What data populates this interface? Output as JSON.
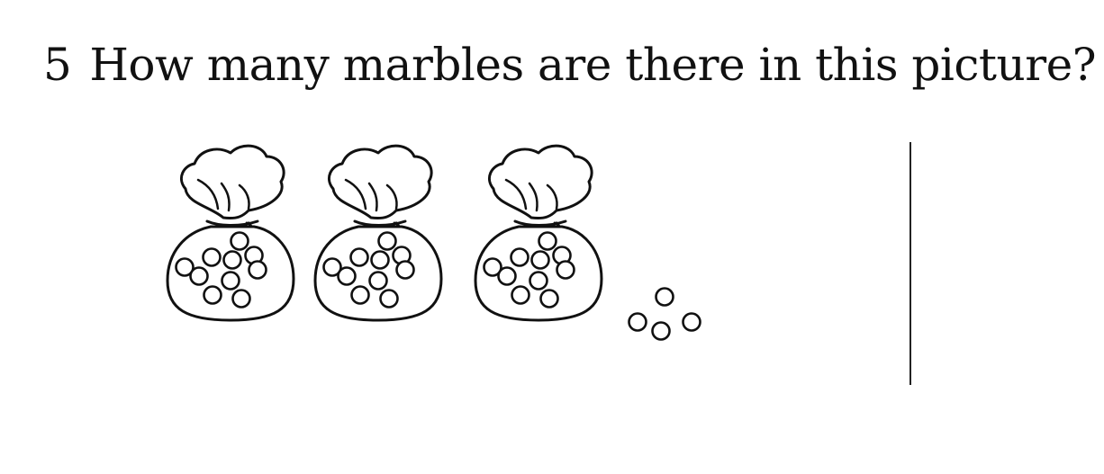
{
  "question": {
    "number": "5",
    "text": "How many marbles are there in this picture?"
  },
  "illustration": {
    "bags": [
      {
        "marbles": 10
      },
      {
        "marbles": 10
      },
      {
        "marbles": 10
      }
    ],
    "loose_marbles": 4,
    "bag_icon": "marble-bag-icon",
    "marble_icon": "marble-icon"
  },
  "colors": {
    "ink": "#111111",
    "paper": "#ffffff"
  }
}
